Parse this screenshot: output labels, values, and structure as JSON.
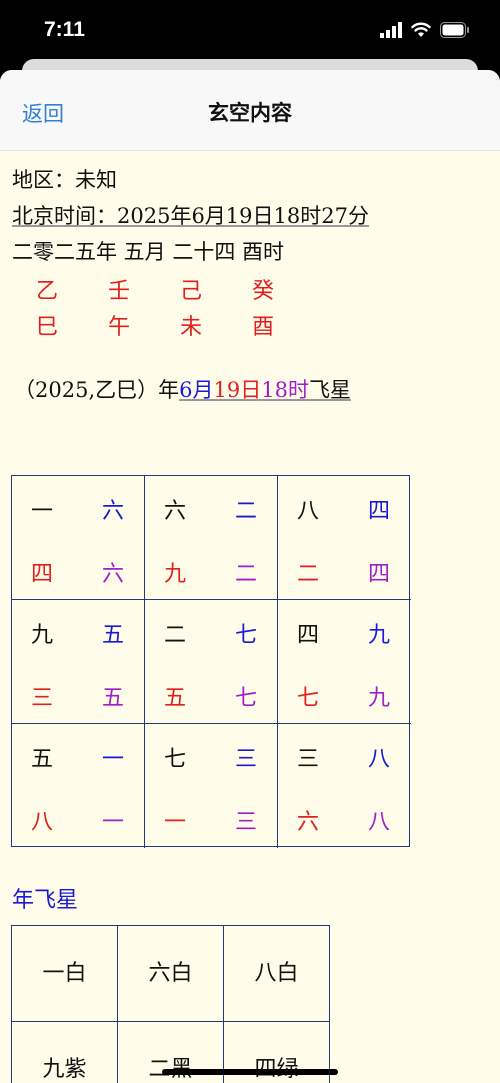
{
  "status_bar": {
    "time": "7:11"
  },
  "nav": {
    "back_label": "返回",
    "title": "玄空内容"
  },
  "info": {
    "region_label": "地区：",
    "region_value": "未知",
    "beijing_label": "北京时间：",
    "beijing_value": "2025年6月19日18时27分",
    "lunar": "二零二五年 五月 二十四 酉时"
  },
  "pillars": {
    "stems": [
      "乙",
      "壬",
      "己",
      "癸"
    ],
    "branches": [
      "巳",
      "午",
      "未",
      "酉"
    ]
  },
  "flying_title": {
    "prefix": "（2025,乙巳）年",
    "month": "6月",
    "day": "19日",
    "hour": "18时",
    "suffix": "飞星"
  },
  "flying_grid": [
    {
      "tl": "一",
      "tr": "六",
      "bl": "四",
      "br": "六"
    },
    {
      "tl": "六",
      "tr": "二",
      "bl": "九",
      "br": "二"
    },
    {
      "tl": "八",
      "tr": "四",
      "bl": "二",
      "br": "四"
    },
    {
      "tl": "九",
      "tr": "五",
      "bl": "三",
      "br": "五"
    },
    {
      "tl": "二",
      "tr": "七",
      "bl": "五",
      "br": "七"
    },
    {
      "tl": "四",
      "tr": "九",
      "bl": "七",
      "br": "九"
    },
    {
      "tl": "五",
      "tr": "一",
      "bl": "八",
      "br": "一"
    },
    {
      "tl": "七",
      "tr": "三",
      "bl": "一",
      "br": "三"
    },
    {
      "tl": "三",
      "tr": "八",
      "bl": "六",
      "br": "八"
    }
  ],
  "year_section": {
    "label": "年飞星",
    "cells": [
      "一白",
      "六白",
      "八白",
      "九紫",
      "二黑",
      "四绿"
    ]
  },
  "colors": {
    "background": "#fffdea",
    "red": "#e02020",
    "blue": "#1a1ad4",
    "purple": "#a020c8",
    "grid_border": "#1e3a7a",
    "link": "#2f7fd6"
  }
}
